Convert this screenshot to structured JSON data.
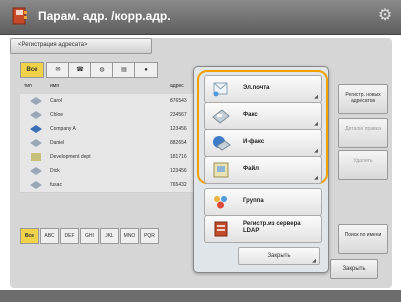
{
  "header": {
    "title": "Парам. адр. /корр.адр."
  },
  "tab": {
    "label": "<Регистрация адресата>"
  },
  "filter": {
    "all_label": "Все"
  },
  "list": {
    "columns": [
      "тип",
      "имя",
      "адрес"
    ],
    "rows": [
      {
        "name": "Carol",
        "num": "876543"
      },
      {
        "name": "Chloe",
        "num": "234567"
      },
      {
        "name": "Company A",
        "num": "123456"
      },
      {
        "name": "Daniel",
        "num": "882654"
      },
      {
        "name": "Development dept",
        "num": "181716"
      },
      {
        "name": "Dick",
        "num": "123456"
      },
      {
        "name": "fusac",
        "num": "765432"
      }
    ]
  },
  "alphabet": [
    "Все",
    "ABC",
    "DEF",
    "GHI",
    "JKL",
    "MNO",
    "PQR"
  ],
  "side": {
    "register": "Регистр. новых адресатов",
    "details": "Детали/ правка",
    "delete": "Удалить",
    "search": "Поиск по имени"
  },
  "popup": {
    "items": [
      {
        "label": "Эл.почта"
      },
      {
        "label": "Факс"
      },
      {
        "label": "И-факс"
      },
      {
        "label": "Файл"
      },
      {
        "label": "Группа"
      },
      {
        "label": "Регистр.из сервера LDAP"
      }
    ],
    "close_label": "Закрыть"
  },
  "right_close": "Закрыть",
  "colors": {
    "highlight": "#f2a100",
    "selected": "#f0d24a"
  }
}
